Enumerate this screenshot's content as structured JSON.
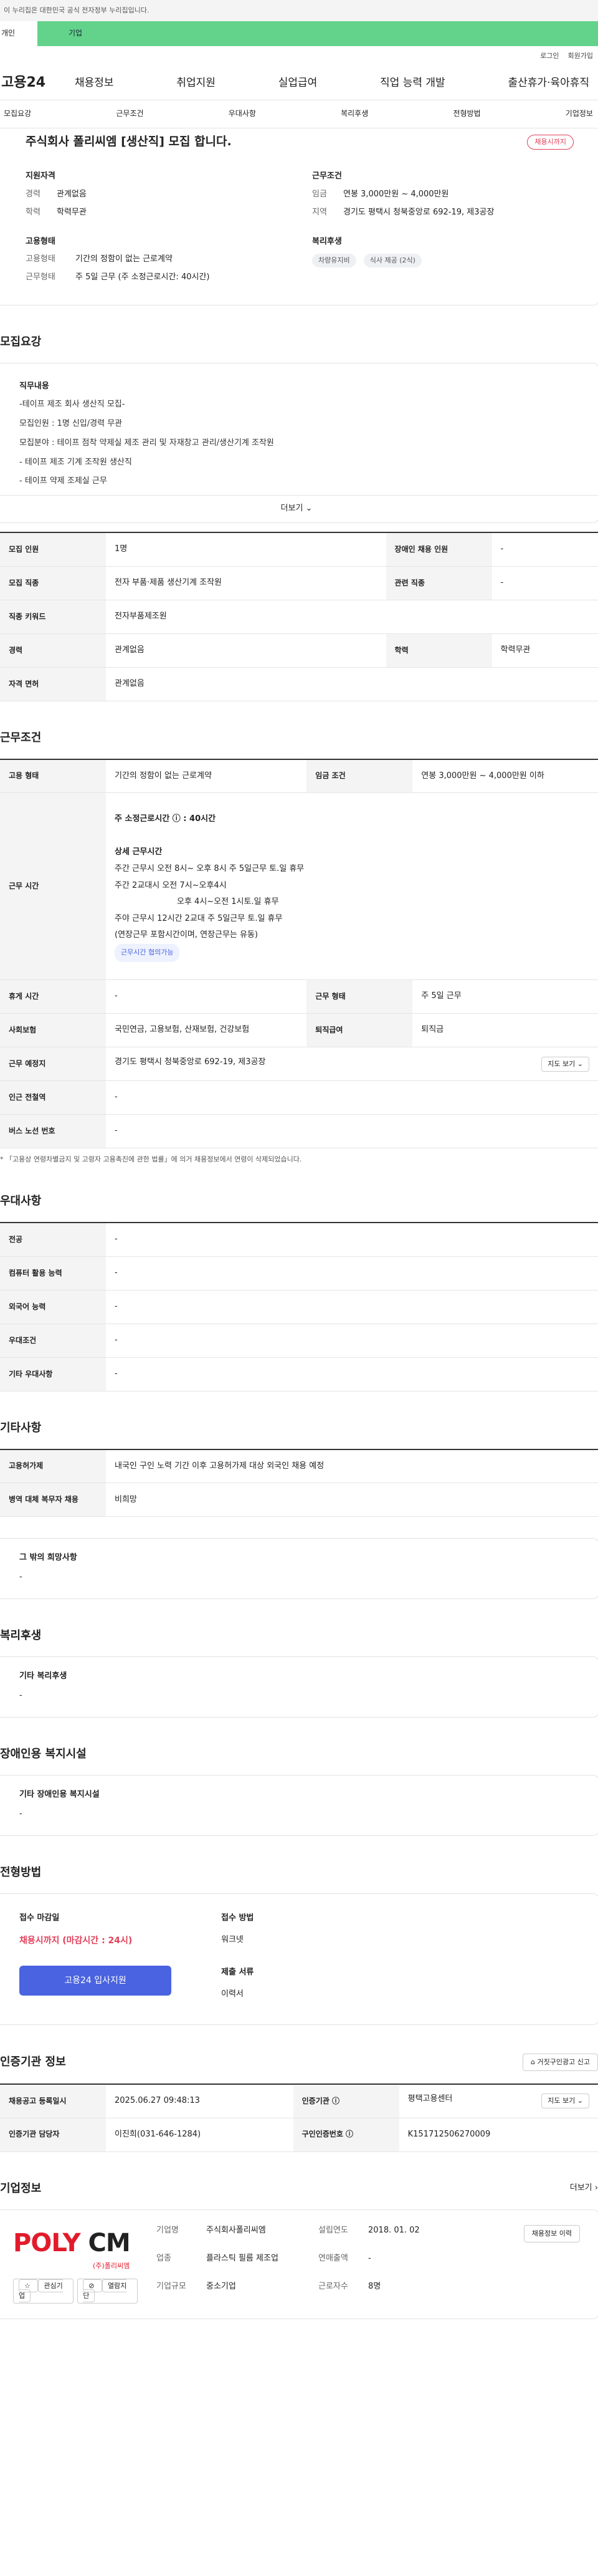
{
  "gov_banner": "이 누리집은 대한민국 공식 전자정부 누리집입니다.",
  "user_types": [
    "개인",
    "기업"
  ],
  "util": [
    "로그인",
    "회원가입"
  ],
  "gnb": {
    "logo": "고용24",
    "menu": [
      "채용정보",
      "취업지원",
      "실업급여",
      "직업 능력 개발",
      "출산휴가·육아휴직"
    ]
  },
  "snb": [
    "모집요강",
    "근무조건",
    "우대사항",
    "복리후생",
    "전형방법",
    "기업정보"
  ],
  "summary": {
    "title": "주식회사 폴리씨엠 [생산직] 모집 합니다.",
    "badge": "채용시까지",
    "qual": {
      "h": "지원자격",
      "rows": [
        [
          "경력",
          "관계없음"
        ],
        [
          "학력",
          "학력무관"
        ]
      ]
    },
    "cond": {
      "h": "근무조건",
      "rows": [
        [
          "임금",
          "연봉 3,000만원 ~ 4,000만원"
        ],
        [
          "지역",
          "경기도 평택시 청북중앙로 692-19, 제3공장"
        ]
      ]
    },
    "emp": {
      "h": "고용형태",
      "rows": [
        [
          "고용형태",
          "기간의 정함이 없는 근로계약"
        ],
        [
          "근무형태",
          "주 5일 근무 (주 소정근로시간: 40시간)"
        ]
      ]
    },
    "welfare": {
      "h": "복리후생",
      "tags": [
        "차량유지비",
        "식사 제공 (2식)"
      ]
    }
  },
  "recruit": {
    "title": "모집요강",
    "duty_h": "직무내용",
    "lines": [
      "-테이프 제조 회사 생산직 모집-",
      "모집인원 : 1명 신입/경력 무관",
      "모집분야 : 테이프 점착 약제실 제조 관리 및 자재창고 관리/생산기계 조작원",
      "- 테이프 제조 기계 조작원 생산직",
      "- 테이프 약제 조제실 근무"
    ],
    "more": "더보기",
    "table": [
      [
        "모집 인원",
        "1명",
        "장애인 채용 인원",
        "-"
      ],
      [
        "모집 직종",
        "전자 부품·제품 생산기계 조작원",
        "관련 직종",
        "-"
      ],
      [
        "직종 키워드",
        "전자부품제조원"
      ],
      [
        "경력",
        "관계없음",
        "학력",
        "학력무관"
      ],
      [
        "자격 면허",
        "관계없음"
      ]
    ]
  },
  "work": {
    "title": "근무조건",
    "emp_type_h": "고용 형태",
    "emp_type": "기간의 정함이 없는 근로계약",
    "wage_h": "임금 조건",
    "wage": "연봉 3,000만원 ~ 4,000만원 이하",
    "hours_h": "근무 시간",
    "hours_lines": [
      "주 소정근로시간 ⓘ : 40시간",
      "",
      "상세 근무시간",
      "주간 근무시 오전 8시~ 오후 8시 주 5일근무 토.일 휴무",
      "주간 2교대시 오전 7시~오후4시",
      "오후 4시~오전 1시토.일 휴무",
      "주야 근무시 12시간 2교대 주 5일근무 토.일 휴무",
      "(연장근무 포함시간이며, 연장근무는 유동)"
    ],
    "hours_tag": "근무시간 협의가능",
    "rows": [
      [
        "휴게 시간",
        "-",
        "근무 형태",
        "주 5일 근무"
      ],
      [
        "사회보험",
        "국민연금, 고용보험, 산재보험, 건강보험",
        "퇴직급여",
        "퇴직금"
      ]
    ],
    "loc_h": "근무 예정지",
    "loc": "경기도 평택시 청북중앙로 692-19, 제3공장",
    "map_btn": "지도 보기",
    "rows2": [
      [
        "인근 전철역",
        "-"
      ],
      [
        "버스 노선 번호",
        "-"
      ]
    ],
    "note": "* 「고용상 연령차별금지 및 고령자 고용촉진에 관한 법률」에 의거 채용정보에서 연령이 삭제되었습니다."
  },
  "pref": {
    "title": "우대사항",
    "rows": [
      [
        "전공",
        "-"
      ],
      [
        "컴퓨터 활용 능력",
        "-"
      ],
      [
        "외국어 능력",
        "-"
      ],
      [
        "우대조건",
        "-"
      ],
      [
        "기타 우대사항",
        "-"
      ]
    ]
  },
  "etc": {
    "title": "기타사항",
    "rows": [
      [
        "고용허가제",
        "내국인 구인 노력 기간 이후 고용허가제 대상 외국인 채용 예정"
      ],
      [
        "병역 대체 복무자 채용",
        "비희망"
      ]
    ],
    "other_h": "그 밖의 희망사항",
    "other": "-"
  },
  "welfare": {
    "title": "복리후생",
    "h": "기타 복리후생",
    "v": "-"
  },
  "disability": {
    "title": "장애인용 복지시설",
    "h": "기타 장애인용 복지시설",
    "v": "-"
  },
  "selection": {
    "title": "전형방법",
    "deadline_h": "접수 마감일",
    "deadline": "채용시까지 (마감시간 : 24시)",
    "apply_btn": "고용24 입사지원",
    "method_h": "접수 방법",
    "method": "워크넷",
    "docs_h": "제출 서류",
    "docs": "이력서"
  },
  "cert": {
    "title": "인증기관 정보",
    "report_btn": "거짓구인광고 신고",
    "rows": [
      [
        "채용공고 등록일시",
        "2025.06.27 09:48:13",
        "인증기관 ⓘ",
        "평택고용센터"
      ],
      [
        "인증기관 담당자",
        "이진희(031-646-1284)",
        "구인인증번호 ⓘ",
        "K151712506270009"
      ]
    ],
    "map_btn": "지도 보기"
  },
  "company": {
    "title": "기업정보",
    "more": "더보기",
    "logo1": "POLY",
    "logo2": "CM",
    "logo_sub": "(주)폴리씨엠",
    "fav": "관심기업",
    "block": "열람지단",
    "btn": "채용정보 이력",
    "grid": [
      [
        "기업명",
        "주식회사폴리씨엠",
        "설립연도",
        "2018. 01. 02"
      ],
      [
        "업종",
        "플라스틱 필름 제조업",
        "연매출액",
        "-"
      ],
      [
        "기업규모",
        "중소기업",
        "근로자수",
        "8명"
      ]
    ]
  }
}
